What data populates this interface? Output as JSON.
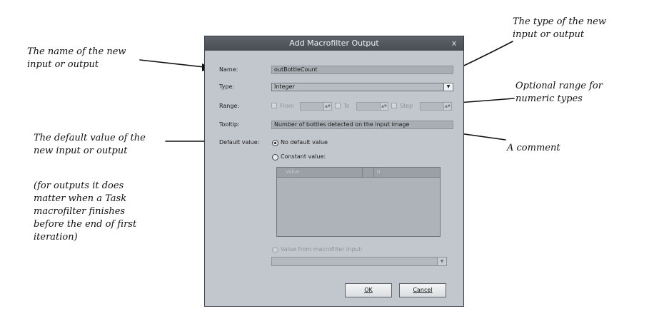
{
  "annotations": {
    "name": [
      "The name of the new",
      "input or output"
    ],
    "type": [
      "The type of the new",
      "input or output"
    ],
    "range": [
      "Optional range for",
      "numeric types"
    ],
    "default_value": [
      "The default value of the",
      "new input or output"
    ],
    "comment": "A comment",
    "outputs_note": [
      "(for outputs it does",
      "matter when a Task",
      "macrofilter finishes",
      "before the end of first",
      "iteration)"
    ]
  },
  "dialog": {
    "title": "Add Macrofilter Output",
    "close_glyph": "x",
    "labels": {
      "name": "Name:",
      "type": "Type:",
      "range": "Range:",
      "tooltip": "Tooltip:",
      "default_value": "Default value:"
    },
    "name_value": "outBottleCount",
    "type_value": "Integer",
    "range": {
      "from": "From",
      "to": "To",
      "step": "Step"
    },
    "tooltip_value": "Number of bottles detected on the input image",
    "default_options": {
      "none": "No default value",
      "constant": "Constant value:",
      "from_input": "Value from macrofilter input:"
    },
    "selected_default": "none",
    "grid": {
      "col_value": "Value",
      "col_index": "0"
    },
    "buttons": {
      "ok": "OK",
      "cancel": "Cancel"
    }
  }
}
